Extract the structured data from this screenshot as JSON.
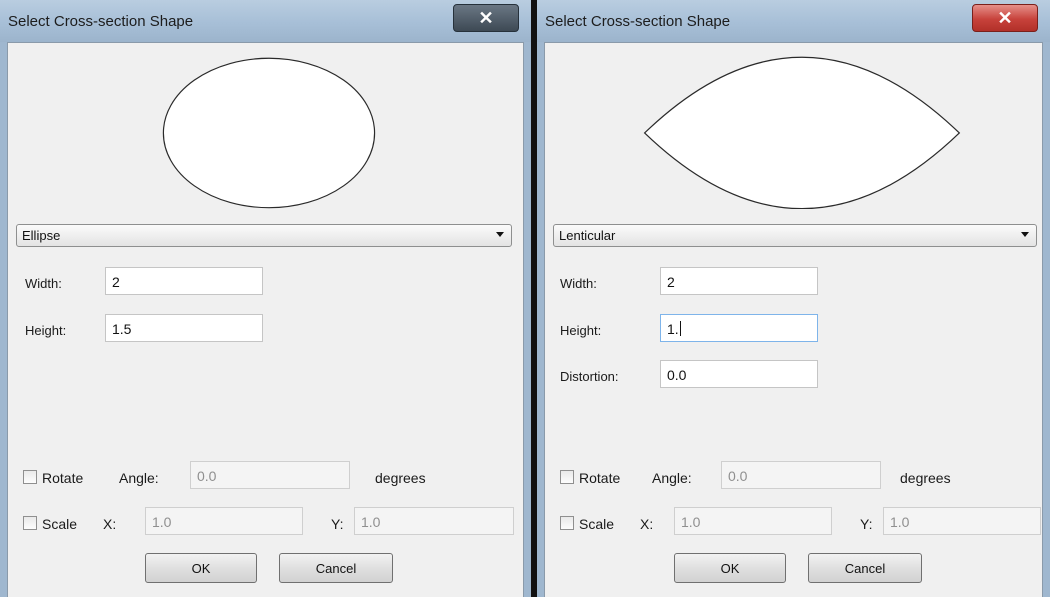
{
  "left_dialog": {
    "title": "Select Cross-section Shape",
    "close_label": "✕",
    "shape": "Ellipse",
    "width_label": "Width:",
    "width_value": "2",
    "height_label": "Height:",
    "height_value": "1.5",
    "rotate_label": "Rotate",
    "angle_label": "Angle:",
    "angle_value": "0.0",
    "degrees_label": "degrees",
    "scale_label": "Scale",
    "x_label": "X:",
    "x_value": "1.0",
    "y_label": "Y:",
    "y_value": "1.0",
    "ok_label": "OK",
    "cancel_label": "Cancel"
  },
  "right_dialog": {
    "title": "Select Cross-section Shape",
    "close_label": "✕",
    "shape": "Lenticular",
    "width_label": "Width:",
    "width_value": "2",
    "height_label": "Height:",
    "height_value": "1.",
    "distortion_label": "Distortion:",
    "distortion_value": "0.0",
    "rotate_label": "Rotate",
    "angle_label": "Angle:",
    "angle_value": "0.0",
    "degrees_label": "degrees",
    "scale_label": "Scale",
    "x_label": "X:",
    "x_value": "1.0",
    "y_label": "Y:",
    "y_value": "1.0",
    "ok_label": "OK",
    "cancel_label": "Cancel"
  }
}
